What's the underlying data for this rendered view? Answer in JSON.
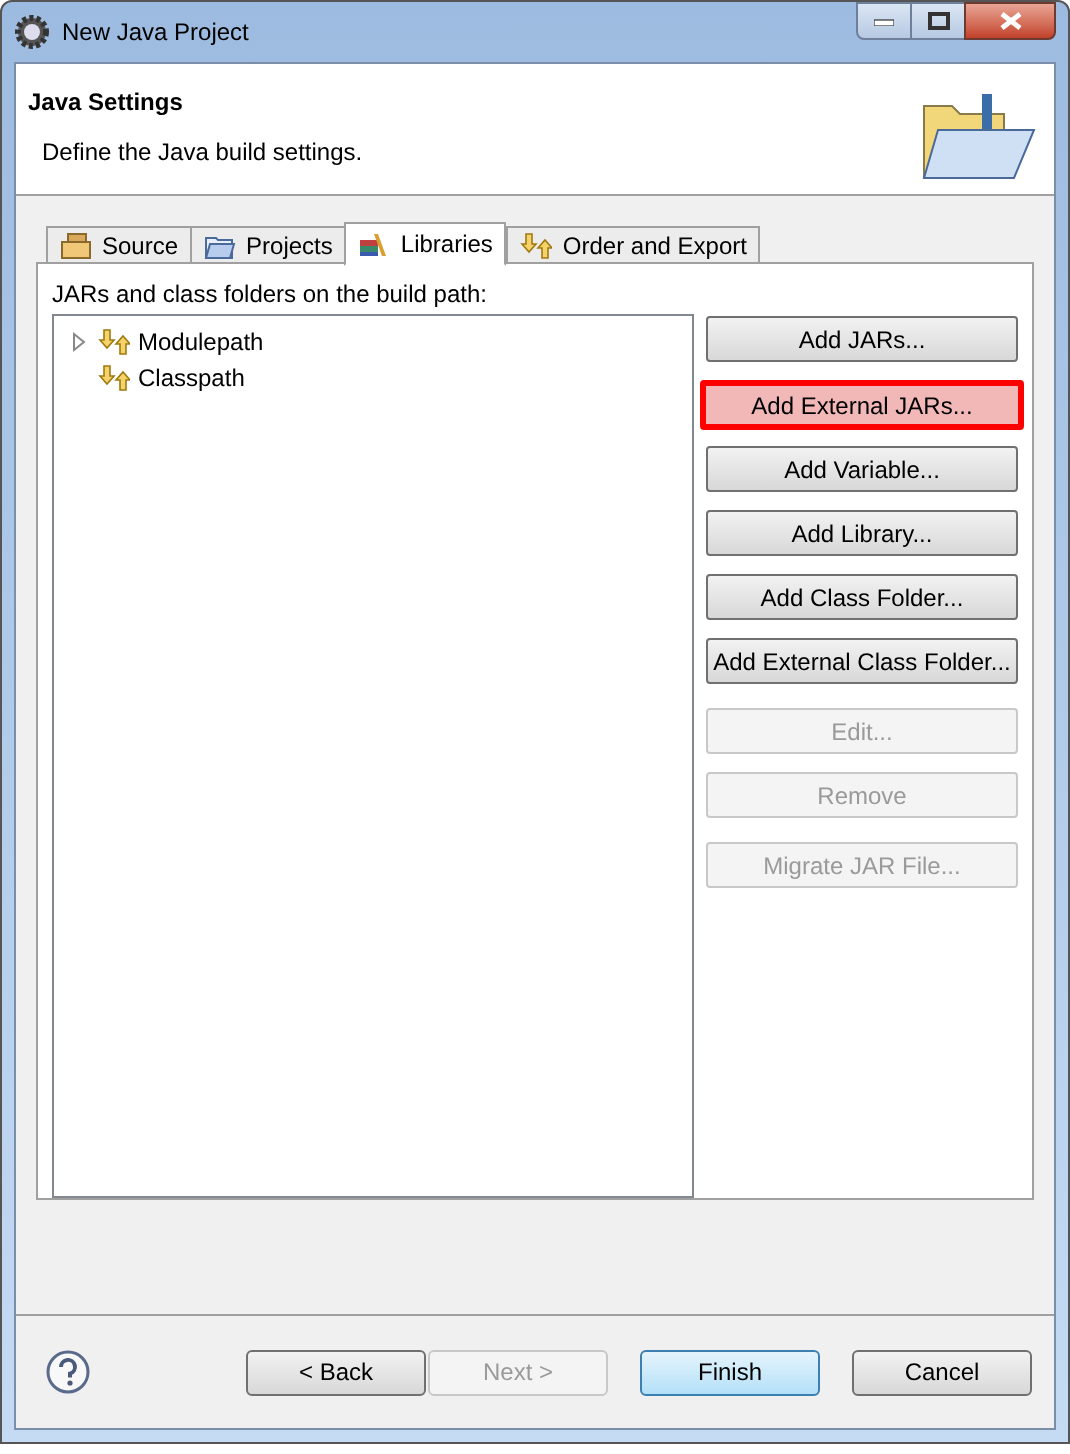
{
  "window": {
    "title": "New Java Project"
  },
  "header": {
    "title": "Java Settings",
    "description": "Define the Java build settings."
  },
  "tabs": [
    {
      "label": "Source",
      "kind": "source",
      "selected": false
    },
    {
      "label": "Projects",
      "kind": "projects",
      "selected": false
    },
    {
      "label": "Libraries",
      "kind": "libraries",
      "selected": true
    },
    {
      "label": "Order and Export",
      "kind": "order",
      "selected": false
    }
  ],
  "panel": {
    "label": "JARs and class folders on the build path:",
    "tree": [
      {
        "label": "Modulepath",
        "has_children": true
      },
      {
        "label": "Classpath",
        "has_children": false
      }
    ],
    "button_groups": [
      {
        "buttons": [
          {
            "label": "Add JARs...",
            "disabled": false,
            "highlighted": false
          },
          {
            "label": "Add External JARs...",
            "disabled": false,
            "highlighted": true
          },
          {
            "label": "Add Variable...",
            "disabled": false,
            "highlighted": false
          },
          {
            "label": "Add Library...",
            "disabled": false,
            "highlighted": false
          },
          {
            "label": "Add Class Folder...",
            "disabled": false,
            "highlighted": false
          },
          {
            "label": "Add External Class Folder...",
            "disabled": false,
            "highlighted": false
          }
        ]
      },
      {
        "buttons": [
          {
            "label": "Edit...",
            "disabled": true,
            "highlighted": false
          },
          {
            "label": "Remove",
            "disabled": true,
            "highlighted": false
          }
        ]
      },
      {
        "buttons": [
          {
            "label": "Migrate JAR File...",
            "disabled": true,
            "highlighted": false
          }
        ]
      }
    ]
  },
  "footer": {
    "buttons": [
      {
        "label": "< Back",
        "disabled": false,
        "default": false
      },
      {
        "label": "Next >",
        "disabled": true,
        "default": false
      },
      {
        "label": "Finish",
        "disabled": false,
        "default": true
      },
      {
        "label": "Cancel",
        "disabled": false,
        "default": false
      }
    ]
  }
}
